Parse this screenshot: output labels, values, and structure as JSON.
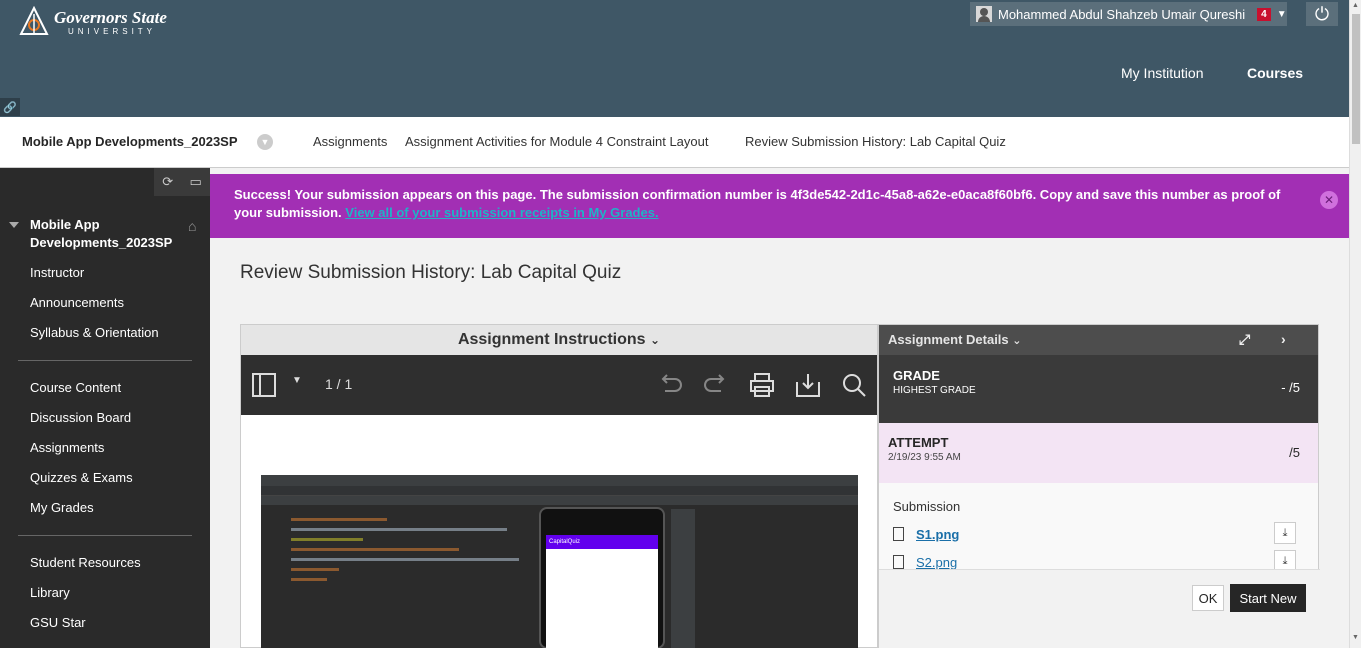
{
  "header": {
    "logo_line1": "Governors State",
    "logo_line2": "UNIVERSITY",
    "user_name": "Mohammed Abdul Shahzeb Umair Qureshi",
    "notification_count": "4",
    "nav_my_institution": "My Institution",
    "nav_courses": "Courses"
  },
  "breadcrumb": {
    "course": "Mobile App Developments_2023SP",
    "items": [
      "Assignments",
      "Assignment Activities for Module 4 Constraint Layout",
      "Review Submission History: Lab Capital Quiz"
    ]
  },
  "sidebar": {
    "course_title": "Mobile App Developments_2023SP",
    "group1": [
      "Instructor",
      "Announcements",
      "Syllabus & Orientation"
    ],
    "group2": [
      "Course Content",
      "Discussion Board",
      "Assignments",
      "Quizzes & Exams",
      "My Grades"
    ],
    "group3": [
      "Student Resources",
      "Library",
      "GSU Star"
    ]
  },
  "success_banner": {
    "message": "Success! Your submission appears on this page. The submission confirmation number is 4f3de542-2d1c-45a8-a62e-e0aca8f60bf6. Copy and save this number as proof of your submission.",
    "link": "View all of your submission receipts in My Grades."
  },
  "page_title": "Review Submission History: Lab Capital Quiz",
  "instructions": {
    "heading": "Assignment Instructions",
    "page_count": "1 / 1",
    "screenshot_app_title": "CapitalQuiz"
  },
  "details": {
    "heading": "Assignment Details",
    "grade_label": "GRADE",
    "grade_sub": "HIGHEST GRADE",
    "grade_value": "- /5",
    "attempt_label": "ATTEMPT",
    "attempt_date": "2/19/23 9:55 AM",
    "attempt_value": "/5",
    "submission_label": "Submission",
    "files": [
      "S1.png",
      "S2.png"
    ],
    "ok_label": "OK",
    "start_new_label": "Start New"
  },
  "colors": {
    "header_bg": "#3f5766",
    "banner_bg": "#a22fb4",
    "sidebar_bg": "#2a2a2a"
  }
}
